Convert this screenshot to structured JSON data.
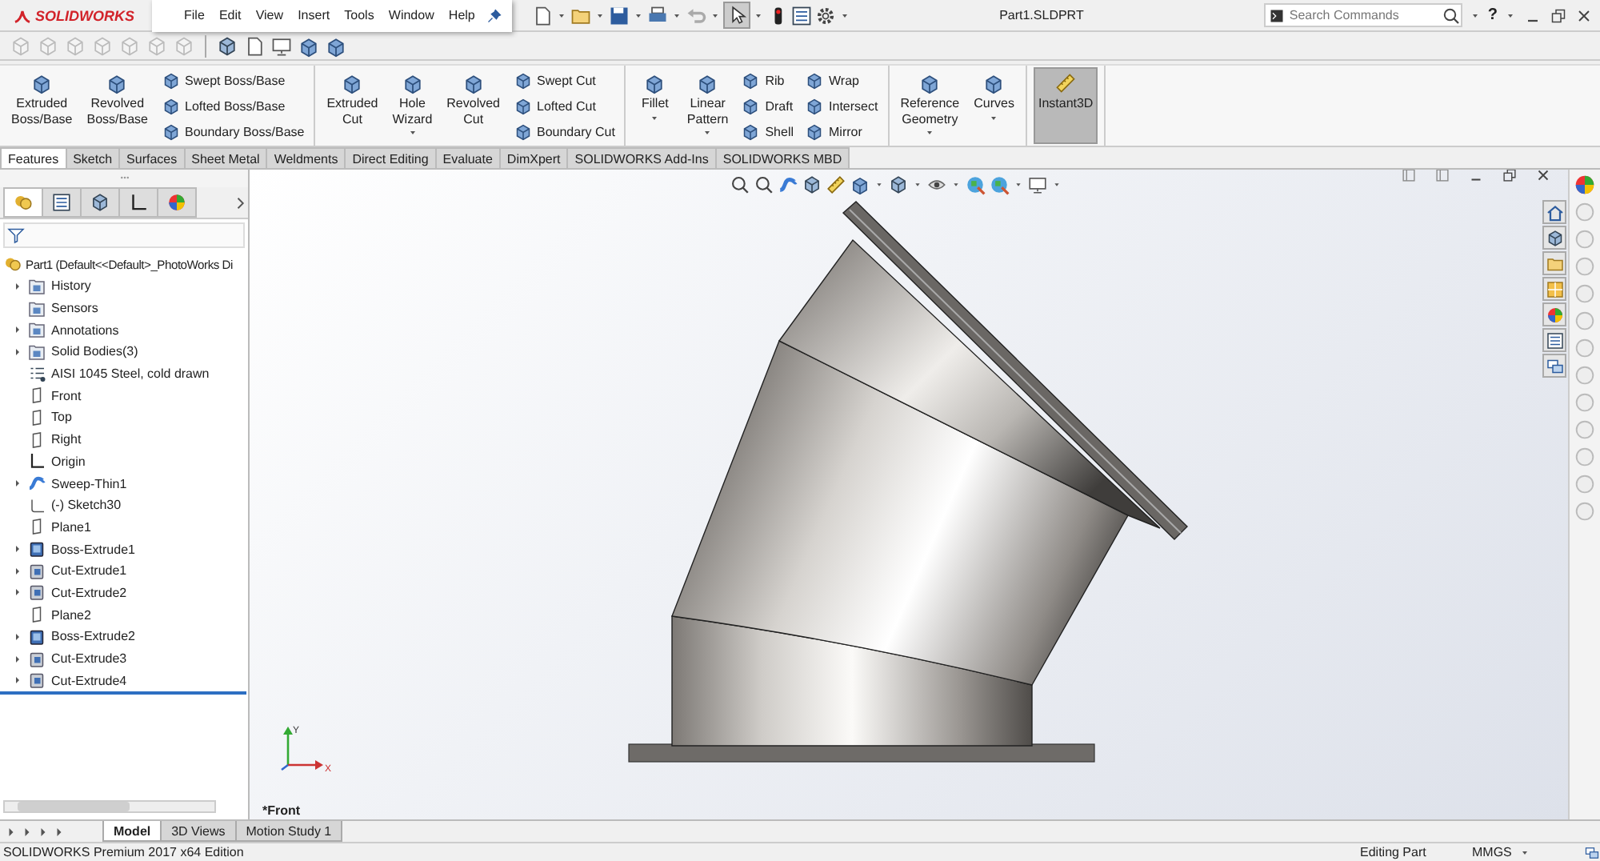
{
  "app": {
    "logo": "SOLIDWORKS",
    "menu": [
      "File",
      "Edit",
      "View",
      "Insert",
      "Tools",
      "Window",
      "Help"
    ],
    "document_title": "Part1.SLDPRT",
    "search": {
      "placeholder": "Search Commands"
    },
    "help": "?"
  },
  "ribbon": {
    "groups": [
      {
        "items": [
          {
            "kind": "big",
            "label": "Extruded\nBoss/Base",
            "menu": false,
            "pressed": false
          },
          {
            "kind": "big",
            "label": "Revolved\nBoss/Base",
            "menu": false,
            "pressed": false
          },
          {
            "kind": "stack",
            "items": [
              "Swept Boss/Base",
              "Lofted Boss/Base",
              "Boundary Boss/Base"
            ]
          }
        ]
      },
      {
        "items": [
          {
            "kind": "big",
            "label": "Extruded\nCut",
            "menu": false,
            "pressed": false
          },
          {
            "kind": "big",
            "label": "Hole\nWizard",
            "menu": true,
            "pressed": false
          },
          {
            "kind": "big",
            "label": "Revolved\nCut",
            "menu": false,
            "pressed": false
          },
          {
            "kind": "stack",
            "items": [
              "Swept Cut",
              "Lofted Cut",
              "Boundary Cut"
            ]
          }
        ]
      },
      {
        "items": [
          {
            "kind": "big",
            "label": "Fillet",
            "menu": true,
            "pressed": false
          },
          {
            "kind": "big",
            "label": "Linear\nPattern",
            "menu": true,
            "pressed": false
          },
          {
            "kind": "stack",
            "items": [
              "Rib",
              "Draft",
              "Shell"
            ]
          },
          {
            "kind": "stack",
            "items": [
              "Wrap",
              "Intersect",
              "Mirror"
            ]
          }
        ]
      },
      {
        "items": [
          {
            "kind": "big",
            "label": "Reference\nGeometry",
            "menu": true,
            "pressed": false
          },
          {
            "kind": "big",
            "label": "Curves",
            "menu": true,
            "pressed": false
          }
        ]
      },
      {
        "items": [
          {
            "kind": "big",
            "label": "Instant3D",
            "menu": false,
            "pressed": true
          }
        ]
      }
    ]
  },
  "command_tabs": [
    {
      "label": "Features",
      "selected": true
    },
    {
      "label": "Sketch",
      "selected": false
    },
    {
      "label": "Surfaces",
      "selected": false
    },
    {
      "label": "Sheet Metal",
      "selected": false
    },
    {
      "label": "Weldments",
      "selected": false
    },
    {
      "label": "Direct Editing",
      "selected": false
    },
    {
      "label": "Evaluate",
      "selected": false
    },
    {
      "label": "DimXpert",
      "selected": false
    },
    {
      "label": "SOLIDWORKS Add-Ins",
      "selected": false
    },
    {
      "label": "SOLIDWORKS MBD",
      "selected": false
    }
  ],
  "feature_tree": {
    "panel_tabs": [
      {
        "selected": true
      },
      {
        "selected": false
      },
      {
        "selected": false
      },
      {
        "selected": false
      },
      {
        "selected": false
      }
    ],
    "root": {
      "label": "Part1  (Default<<Default>_PhotoWorks Di",
      "kind": "part",
      "children": [
        {
          "label": "History",
          "kind": "folder",
          "expandable": true
        },
        {
          "label": "Sensors",
          "kind": "folder",
          "expandable": false
        },
        {
          "label": "Annotations",
          "kind": "folder",
          "expandable": true
        },
        {
          "label": "Solid Bodies(3)",
          "kind": "folder",
          "expandable": true
        },
        {
          "label": "AISI 1045 Steel, cold drawn",
          "kind": "material",
          "expandable": false
        },
        {
          "label": "Front",
          "kind": "plane",
          "expandable": false
        },
        {
          "label": "Top",
          "kind": "plane",
          "expandable": false
        },
        {
          "label": "Right",
          "kind": "plane",
          "expandable": false
        },
        {
          "label": "Origin",
          "kind": "origin",
          "expandable": false
        },
        {
          "label": "Sweep-Thin1",
          "kind": "sweep",
          "expandable": true
        },
        {
          "label": "(-) Sketch30",
          "kind": "sketch",
          "expandable": false
        },
        {
          "label": "Plane1",
          "kind": "plane",
          "expandable": false
        },
        {
          "label": "Boss-Extrude1",
          "kind": "boss",
          "expandable": true
        },
        {
          "label": "Cut-Extrude1",
          "kind": "cut",
          "expandable": true
        },
        {
          "label": "Cut-Extrude2",
          "kind": "cut",
          "expandable": true
        },
        {
          "label": "Plane2",
          "kind": "plane",
          "expandable": false
        },
        {
          "label": "Boss-Extrude2",
          "kind": "boss",
          "expandable": true
        },
        {
          "label": "Cut-Extrude3",
          "kind": "cut",
          "expandable": true
        },
        {
          "label": "Cut-Extrude4",
          "kind": "cut",
          "expandable": true
        }
      ]
    }
  },
  "viewport": {
    "view_name": "*Front",
    "triad": {
      "x_label": "X",
      "y_label": "Y"
    }
  },
  "bottom_tabs": [
    {
      "label": "Model",
      "selected": true
    },
    {
      "label": "3D Views",
      "selected": false
    },
    {
      "label": "Motion Study 1",
      "selected": false
    }
  ],
  "status_bar": {
    "edition": "SOLIDWORKS Premium 2017 x64 Edition",
    "mode": "Editing Part",
    "units": "MMGS"
  }
}
